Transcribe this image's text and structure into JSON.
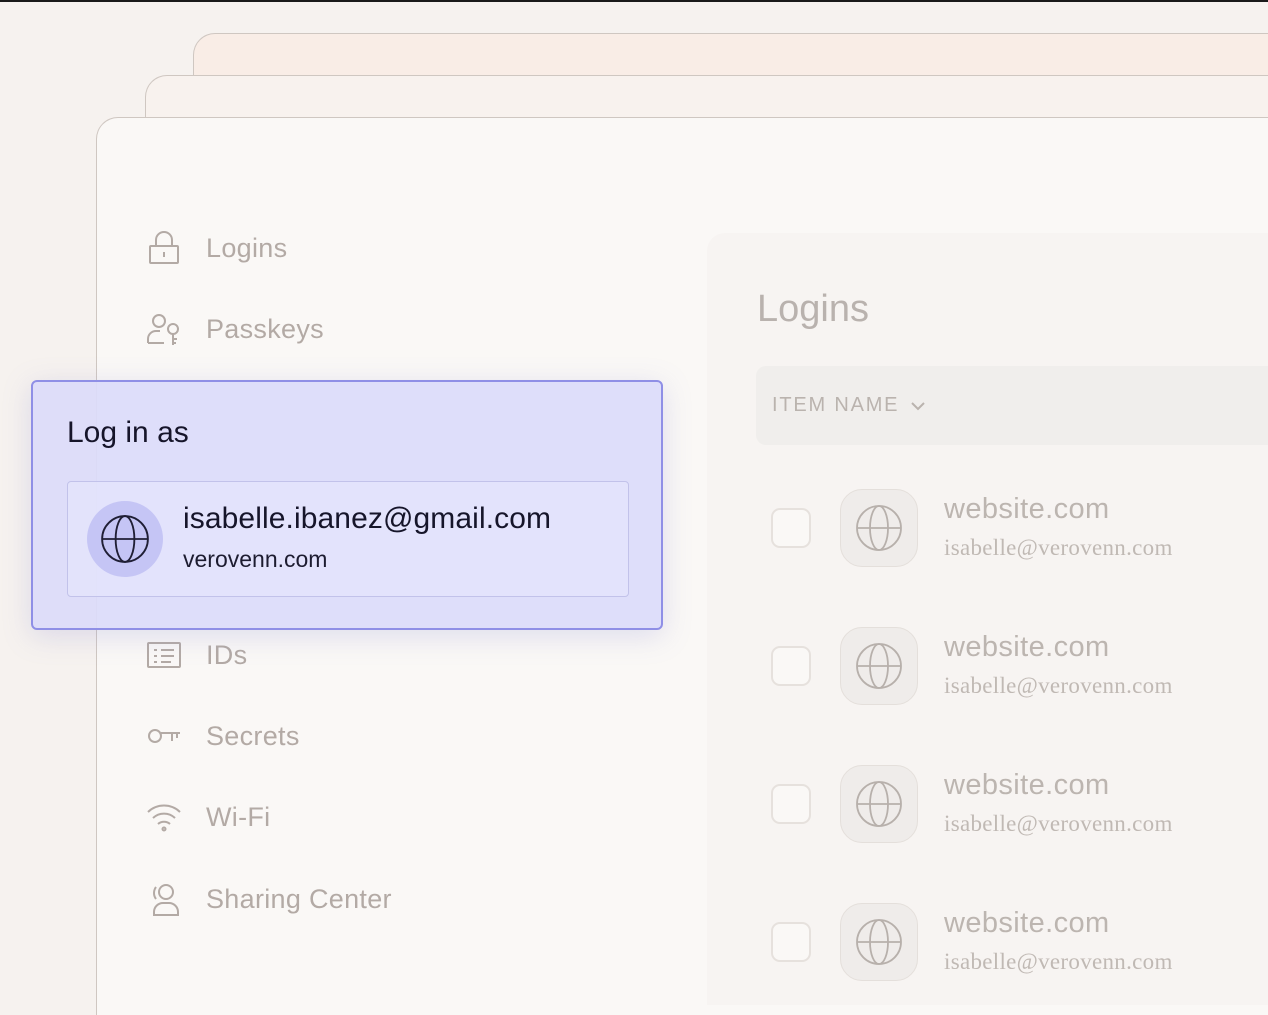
{
  "sidebar": {
    "items": [
      {
        "label": "Logins",
        "icon": "lock-icon"
      },
      {
        "label": "Passkeys",
        "icon": "person-key-icon"
      },
      {
        "label": "IDs",
        "icon": "id-card-icon"
      },
      {
        "label": "Secrets",
        "icon": "key-icon"
      },
      {
        "label": "Wi-Fi",
        "icon": "wifi-icon"
      },
      {
        "label": "Sharing Center",
        "icon": "sharing-person-icon"
      }
    ]
  },
  "main": {
    "title": "Logins",
    "column_header": "ITEM NAME",
    "rows": [
      {
        "title": "website.com",
        "subtitle": "isabelle@verovenn.com"
      },
      {
        "title": "website.com",
        "subtitle": "isabelle@verovenn.com"
      },
      {
        "title": "website.com",
        "subtitle": "isabelle@verovenn.com"
      },
      {
        "title": "website.com",
        "subtitle": "isabelle@verovenn.com"
      }
    ]
  },
  "popup": {
    "title": "Log in as",
    "account": {
      "email": "isabelle.ibanez@gmail.com",
      "site": "verovenn.com",
      "icon": "globe-icon"
    }
  },
  "colors": {
    "accent": "#8f8fe6",
    "popup_bg": "#dcdcfa",
    "muted_text": "#b3aaa5"
  }
}
